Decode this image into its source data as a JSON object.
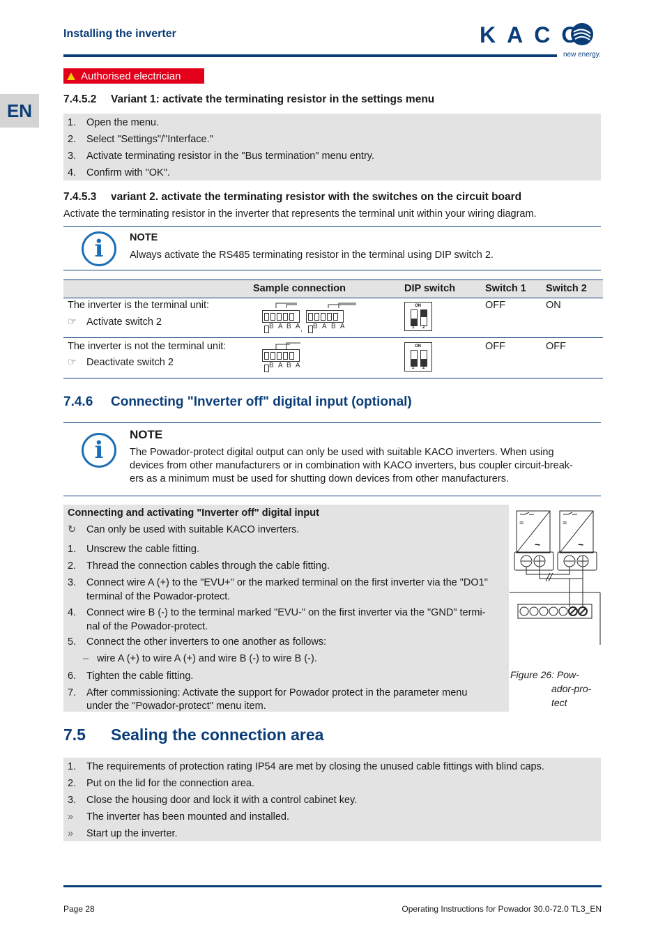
{
  "header": {
    "section_title": "Installing the inverter",
    "logo_text": "KACO",
    "logo_tagline": "new energy."
  },
  "language_tab": "EN",
  "qualification_badge": {
    "icon": "warning-triangle-icon",
    "label": "Authorised electrician"
  },
  "section_7452": {
    "number": "7.4.5.2",
    "title": "Variant 1: activate the terminating resistor in the settings menu",
    "steps": [
      {
        "n": "1.",
        "text": "Open the menu."
      },
      {
        "n": "2.",
        "text": "Select \"Settings\"/\"Interface.\""
      },
      {
        "n": "3.",
        "text": "Activate terminating resistor in the \"Bus termination\" menu entry."
      },
      {
        "n": "4.",
        "text": "Confirm with \"OK\"."
      }
    ]
  },
  "section_7453": {
    "number": "7.4.5.3",
    "title": "variant 2. activate the terminating resistor with the switches on the circuit board",
    "intro": "Activate the terminating resistor in the inverter that represents the terminal unit within your wiring diagram.",
    "note": {
      "icon": "info-icon",
      "title": "NOTE",
      "text": "Always activate the RS485 terminating resistor in the terminal using DIP switch 2."
    },
    "table": {
      "headers": [
        "",
        "Sample connection",
        "DIP switch",
        "Switch 1",
        "Switch 2"
      ],
      "rows": [
        {
          "condition": "The inverter is the terminal unit:",
          "action_icon": "pointing-hand-icon",
          "action": "Activate switch 2",
          "terminal_labels": [
            "B A",
            "B A",
            "B A",
            "B A"
          ],
          "separator": ",",
          "dip_on_label": "ON",
          "dip_numbers": [
            "1",
            "2"
          ],
          "switch1": "OFF",
          "switch2": "ON"
        },
        {
          "condition": "The inverter is not the terminal unit:",
          "action_icon": "pointing-hand-icon",
          "action": "Deactivate switch 2",
          "terminal_labels": [
            "B A",
            "B A"
          ],
          "dip_on_label": "ON",
          "dip_numbers": [
            "1",
            "2"
          ],
          "switch1": "OFF",
          "switch2": "OFF"
        }
      ]
    }
  },
  "section_746": {
    "number": "7.4.6",
    "title": "Connecting \"Inverter off\" digital input (optional)",
    "note": {
      "icon": "info-icon",
      "title": "NOTE",
      "lines": [
        "The Powador-protect digital output can only be used with suitable KACO inverters.  When using",
        "devices from other manufacturers or in combination with KACO inverters, bus coupler circuit-break-",
        "ers as a minimum must be used for shutting down devices from other manufacturers."
      ]
    },
    "procedure": {
      "title": "Connecting and activating \"Inverter off\" digital input",
      "precondition_icon": "circular-arrow-icon",
      "precondition": "Can only be used with suitable KACO inverters.",
      "steps": [
        {
          "n": "1.",
          "lines": [
            "Unscrew the cable fitting."
          ]
        },
        {
          "n": "2.",
          "lines": [
            "Thread the connection cables through the cable fitting."
          ]
        },
        {
          "n": "3.",
          "lines": [
            "Connect wire A (+) to the \"EVU+\" or the marked terminal on the first inverter via the \"DO1\"",
            "terminal of the Powador-protect."
          ]
        },
        {
          "n": "4.",
          "lines": [
            "Connect wire B (-) to the terminal marked \"EVU-\" on the first inverter via the \"GND\" termi-",
            "nal of the Powador-protect."
          ]
        },
        {
          "n": "5.",
          "lines": [
            "Connect the other inverters to one another as follows:"
          ]
        },
        {
          "n": "–",
          "lines": [
            "wire A (+) to wire A (+) and wire B (-) to wire B (-)."
          ],
          "sub": true
        },
        {
          "n": "6.",
          "lines": [
            "Tighten the cable fitting."
          ]
        },
        {
          "n": "7.",
          "lines": [
            "After commissioning: Activate the support for Powador protect in the parameter menu",
            "under the \"Powador-protect\" menu item."
          ]
        }
      ]
    },
    "figure": {
      "caption_label": "Figure 26:",
      "caption_lines": [
        "Pow-",
        "ador-pro-",
        "tect"
      ],
      "dc_symbol": "=",
      "ac_symbol": "~"
    }
  },
  "section_75": {
    "number": "7.5",
    "title": "Sealing the connection area",
    "steps": [
      {
        "n": "1.",
        "text": "The requirements of protection rating IP54 are met by closing the unused cable fittings with blind caps."
      },
      {
        "n": "2.",
        "text": "Put on the lid for the connection area."
      },
      {
        "n": "3.",
        "text": "Close the housing door and lock it with a control cabinet key."
      },
      {
        "n": "»",
        "text": "The inverter has been mounted and installed."
      },
      {
        "n": "»",
        "text": "Start up the inverter."
      }
    ]
  },
  "footer": {
    "page": "Page 28",
    "document": "Operating Instructions for Powador 30.0-72.0 TL3_EN"
  }
}
